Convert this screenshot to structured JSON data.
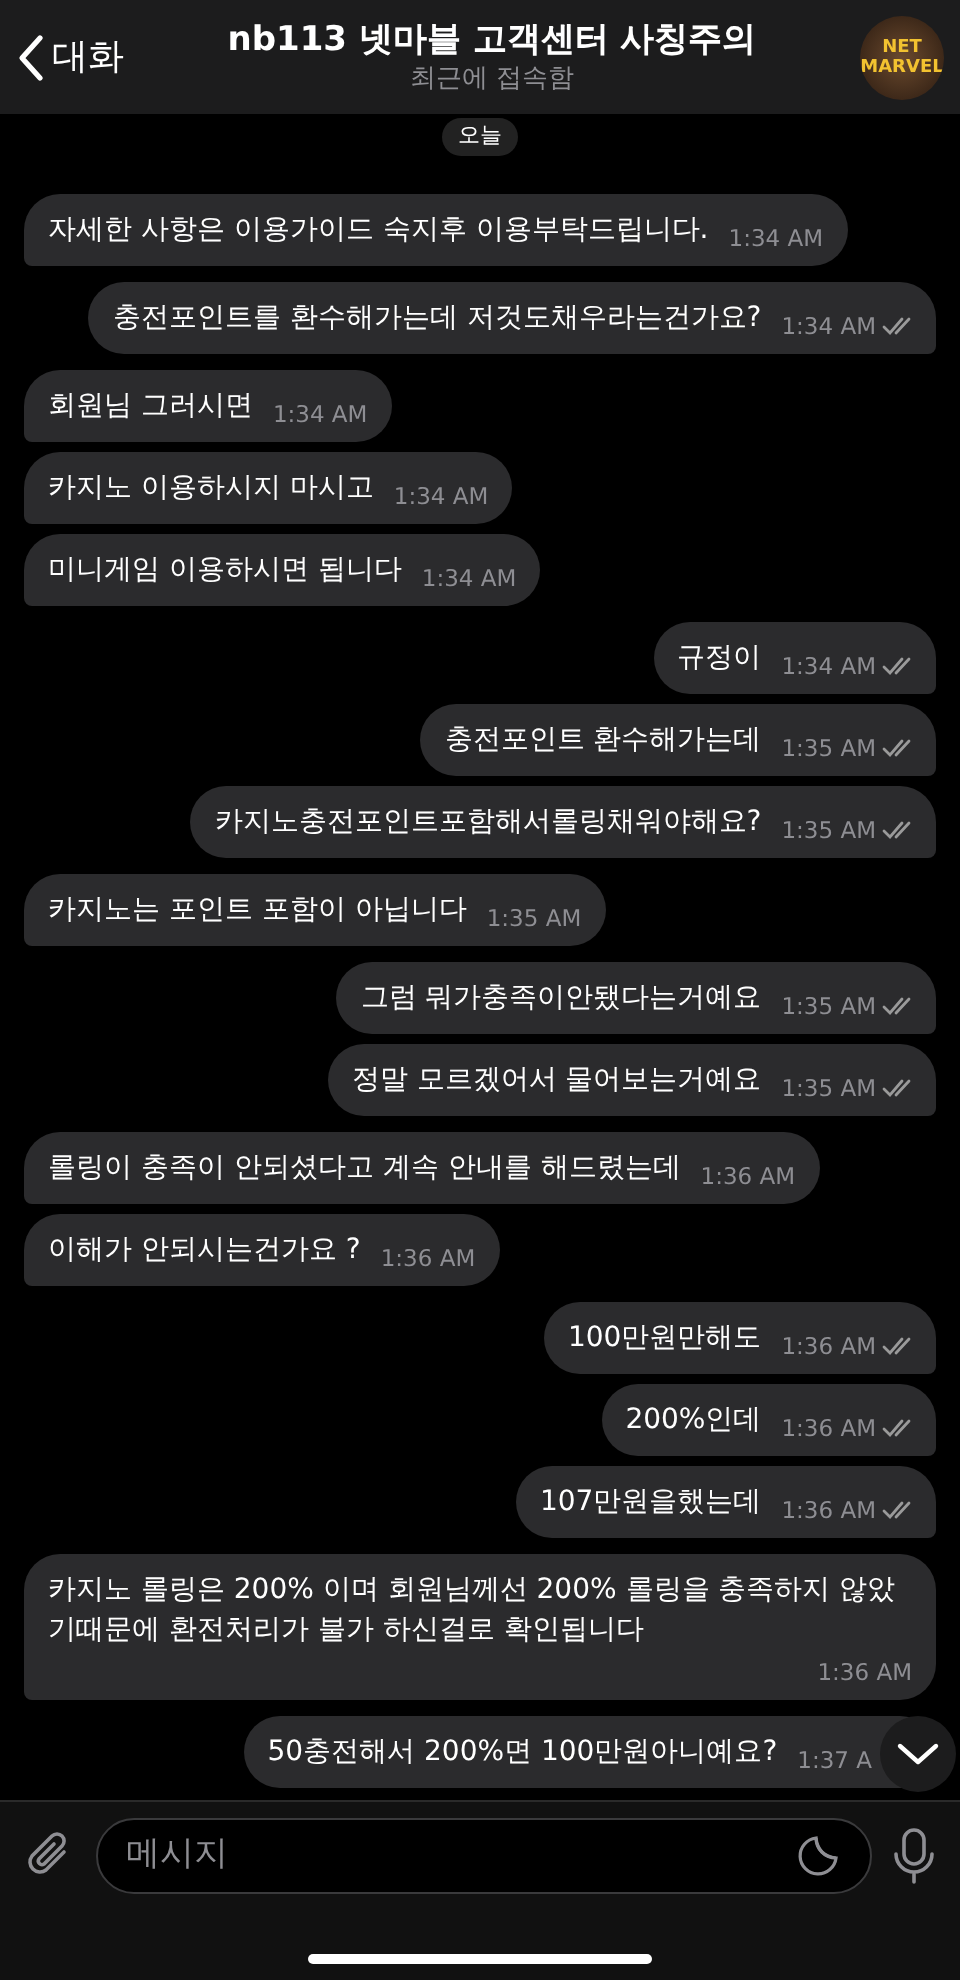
{
  "header": {
    "back_label": "대화",
    "title": "nb113 넷마블 고객센터 사칭주의",
    "status": "최근에 접속함",
    "avatar_lines": [
      "NET",
      "MARVEL"
    ]
  },
  "date_pill": "오늘",
  "messages": [
    {
      "kind": "incoming",
      "text": "자세한 사항은 이용가이드 숙지후 이용부탁드립니다.",
      "time": "1:34 AM"
    },
    {
      "kind": "outgoing",
      "text": "충전포인트를 환수해가는데 저것도채우라는건가요?",
      "time": "1:34 AM",
      "read": true
    },
    {
      "kind": "incoming",
      "text": "회원님 그러시면",
      "time": "1:34 AM"
    },
    {
      "kind": "incoming",
      "text": "카지노 이용하시지 마시고",
      "time": "1:34 AM"
    },
    {
      "kind": "incoming",
      "text": "미니게임 이용하시면 됩니다",
      "time": "1:34 AM"
    },
    {
      "kind": "outgoing",
      "text": "규정이",
      "time": "1:34 AM",
      "read": true
    },
    {
      "kind": "outgoing",
      "text": "충전포인트 환수해가는데",
      "time": "1:35 AM",
      "read": true
    },
    {
      "kind": "outgoing",
      "text": "카지노충전포인트포함해서롤링채워야해요?",
      "time": "1:35 AM",
      "read": true
    },
    {
      "kind": "incoming",
      "text": "카지노는 포인트 포함이 아닙니다",
      "time": "1:35 AM"
    },
    {
      "kind": "outgoing",
      "text": "그럼 뭐가충족이안됐다는거예요",
      "time": "1:35 AM",
      "read": true
    },
    {
      "kind": "outgoing",
      "text": "정말 모르겠어서 물어보는거예요",
      "time": "1:35 AM",
      "read": true
    },
    {
      "kind": "incoming",
      "text": "롤링이 충족이 안되셨다고 계속 안내를 해드렸는데",
      "time": "1:36 AM"
    },
    {
      "kind": "incoming",
      "text": "이해가 안되시는건가요 ?",
      "time": "1:36 AM"
    },
    {
      "kind": "outgoing",
      "text": "100만원만해도",
      "time": "1:36 AM",
      "read": true
    },
    {
      "kind": "outgoing",
      "text": "200%인데",
      "time": "1:36 AM",
      "read": true
    },
    {
      "kind": "outgoing",
      "text": "107만원을했는데",
      "time": "1:36 AM",
      "read": true
    },
    {
      "kind": "incoming",
      "text": "카지노 롤링은 200% 이며 회원님께선 200% 롤링을 충족하지 않았기때문에 환전처리가 불가 하신걸로 확인됩니다",
      "time": "1:36 AM"
    },
    {
      "kind": "outgoing",
      "text": "50충전해서 200%면 100만원아니예요?",
      "time": "1:37 A"
    }
  ],
  "composer": {
    "placeholder": "메시지"
  }
}
